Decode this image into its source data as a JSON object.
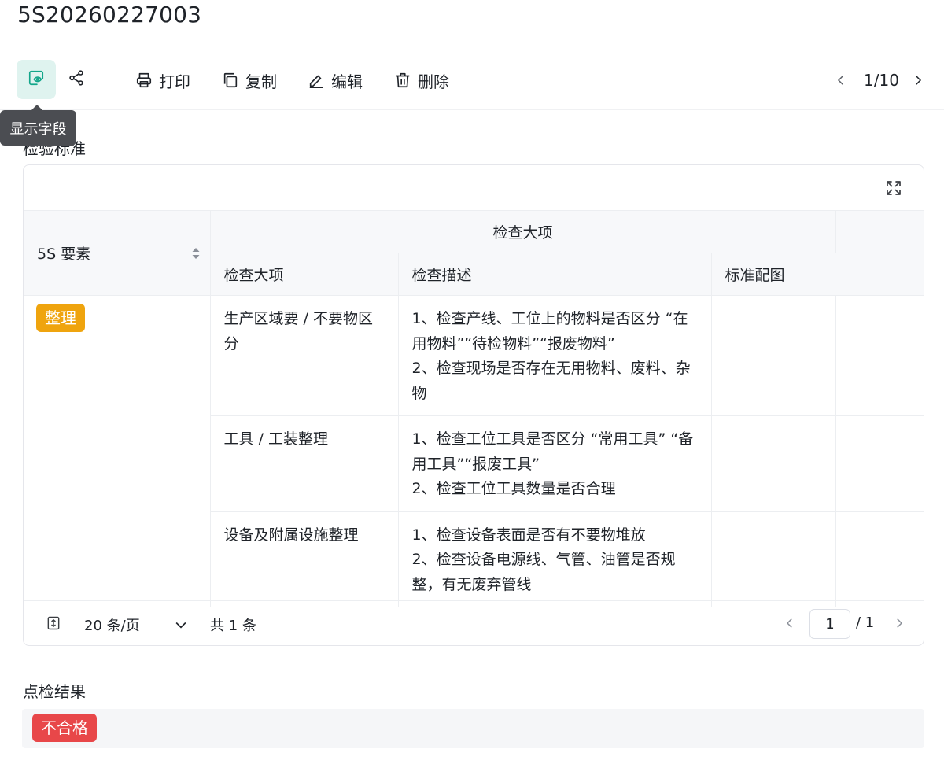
{
  "record": {
    "id": "5S20260227003"
  },
  "toolbar": {
    "tooltip": "显示字段",
    "actions": {
      "print": "打印",
      "copy": "复制",
      "edit": "编辑",
      "delete": "删除"
    },
    "pager": {
      "text": "1/10"
    }
  },
  "colors": {
    "accent": "#13a68a",
    "tag_orange": "#efa40e",
    "tag_red": "#e84749"
  },
  "inspection_standard": {
    "label": "检验标准",
    "table": {
      "header": {
        "element": "5S 要素",
        "group": "检查大项",
        "sub": [
          "检查大项",
          "检查描述",
          "标准配图"
        ]
      },
      "element_tag": "整理",
      "rows": [
        {
          "item": "生产区域要 / 不要物区分",
          "desc": "1、检查产线、工位上的物料是否区分 “在用物料”“待检物料”“报废物料”\n2、检查现场是否存在无用物料、废料、杂物",
          "image": ""
        },
        {
          "item": "工具 / 工装整理",
          "desc": "1、检查工位工具是否区分 “常用工具” “备用工具”“报废工具”\n2、检查工位工具数量是否合理",
          "image": ""
        },
        {
          "item": "设备及附属设施整理",
          "desc": "1、检查设备表面是否有不要物堆放\n2、检查设备电源线、气管、油管是否规整，有无废弃管线",
          "image": ""
        }
      ]
    },
    "footer": {
      "page_size": "20 条/页",
      "total": "共 1 条",
      "current_page": "1",
      "total_pages": "/ 1"
    }
  },
  "check_result": {
    "label": "点检结果",
    "value": "不合格"
  }
}
